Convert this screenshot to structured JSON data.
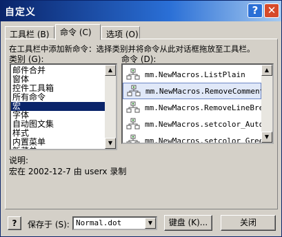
{
  "window": {
    "title": "自定义",
    "help_glyph": "?",
    "close_glyph": "✕"
  },
  "tabs": [
    {
      "label": "工具栏 (B)",
      "active": false
    },
    {
      "label": "命令 (C)",
      "active": true
    },
    {
      "label": "选项 (O)",
      "active": false
    }
  ],
  "instructions": "在工具栏中添加新命令：选择类别并将命令从此对话框拖放至工具栏。",
  "categories": {
    "label": "类别 (G):",
    "items": [
      "邮件合并",
      "窗体",
      "控件工具箱",
      "所有命令",
      "宏",
      "字体",
      "自动图文集",
      "样式",
      "内置菜单",
      "新菜单"
    ],
    "selected_index": 4
  },
  "commands": {
    "label": "命令 (D):",
    "items": [
      "mm.NewMacros.ListPlain",
      "mm.NewMacros.RemoveComments",
      "mm.NewMacros.RemoveLineBreal",
      "mm.NewMacros.setcolor_Auto",
      "mm.NewMacros.setcolor_Green"
    ],
    "selected_index": 1
  },
  "description": {
    "label": "说明:",
    "text": "宏在 2002-12-7 由 userx 录制"
  },
  "footer": {
    "help_glyph": "?",
    "save_in_label": "保存于 (S):",
    "save_in_value": "Normal.dot",
    "keyboard_button": "键盘 (K)...",
    "close_button": "关闭"
  },
  "icons": {
    "macro": "macro-icon",
    "scroll_up": "▲",
    "scroll_down": "▼",
    "dropdown": "▼"
  }
}
